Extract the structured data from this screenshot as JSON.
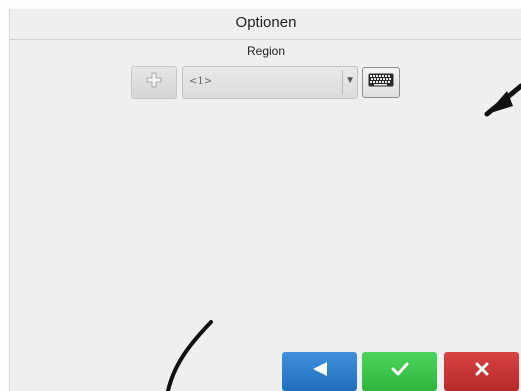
{
  "header": {
    "title": "Optionen"
  },
  "region": {
    "label": "Region",
    "selected": "<1>"
  },
  "icons": {
    "add": "plus-icon",
    "dropdown": "chevron-down-icon",
    "keyboard": "keyboard-icon",
    "back": "arrow-left-icon",
    "confirm": "check-icon",
    "cancel": "close-icon"
  },
  "colors": {
    "back": "#2f7fd0",
    "confirm": "#3cc04c",
    "cancel": "#c83434"
  }
}
